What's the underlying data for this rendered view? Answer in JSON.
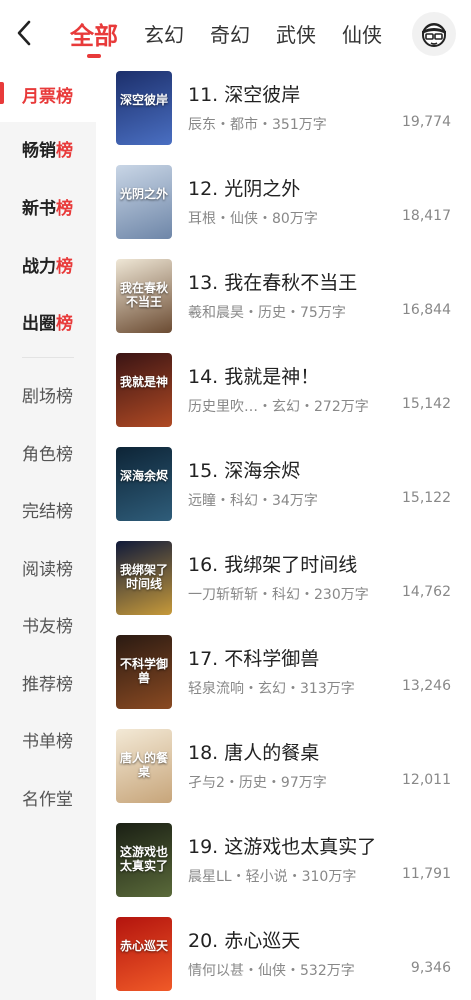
{
  "header": {
    "tabs": [
      {
        "label": "全部",
        "active": true
      },
      {
        "label": "玄幻",
        "active": false
      },
      {
        "label": "奇幻",
        "active": false
      },
      {
        "label": "武侠",
        "active": false
      },
      {
        "label": "仙侠",
        "active": false
      }
    ],
    "back_icon": "chevron-left-icon",
    "avatar_icon": "user-avatar-icon"
  },
  "sidebar": {
    "items": [
      {
        "label": "月票榜",
        "state": "active"
      },
      {
        "label": "畅销榜",
        "state": "bold"
      },
      {
        "label": "新书榜",
        "state": "bold"
      },
      {
        "label": "战力榜",
        "state": "bold"
      },
      {
        "label": "出圈榜",
        "state": "bold"
      },
      {
        "label": "剧场榜",
        "state": "normal"
      },
      {
        "label": "角色榜",
        "state": "normal"
      },
      {
        "label": "完结榜",
        "state": "normal"
      },
      {
        "label": "阅读榜",
        "state": "normal"
      },
      {
        "label": "书友榜",
        "state": "normal"
      },
      {
        "label": "推荐榜",
        "state": "normal"
      },
      {
        "label": "书单榜",
        "state": "normal"
      },
      {
        "label": "名作堂",
        "state": "normal"
      }
    ]
  },
  "books": [
    {
      "title": "11. 深空彼岸",
      "meta": "辰东・都市・351万字",
      "count": "19,774",
      "cover_text": "深空彼岸",
      "cover_colors": [
        "#1c2f6b",
        "#4a6fc2"
      ]
    },
    {
      "title": "12. 光阴之外",
      "meta": "耳根・仙侠・80万字",
      "count": "18,417",
      "cover_text": "光阴之外",
      "cover_colors": [
        "#c9d6e6",
        "#6e86a8"
      ]
    },
    {
      "title": "13. 我在春秋不当王",
      "meta": "羲和晨昊・历史・75万字",
      "count": "16,844",
      "cover_text": "我在春秋不当王",
      "cover_colors": [
        "#efe7d6",
        "#6b4b32"
      ]
    },
    {
      "title": "14. 我就是神！",
      "meta": "历史里吹…・玄幻・272万字",
      "count": "15,142",
      "cover_text": "我就是神",
      "cover_colors": [
        "#3a1414",
        "#b04a24"
      ]
    },
    {
      "title": "15. 深海余烬",
      "meta": "远瞳・科幻・34万字",
      "count": "15,122",
      "cover_text": "深海余烬",
      "cover_colors": [
        "#0d2436",
        "#2f5d7a"
      ]
    },
    {
      "title": "16. 我绑架了时间线",
      "meta": "一刀斩斩斩・科幻・230万字",
      "count": "14,762",
      "cover_text": "我绑架了时间线",
      "cover_colors": [
        "#101a3a",
        "#c79a3a"
      ]
    },
    {
      "title": "17. 不科学御兽",
      "meta": "轻泉流响・玄幻・313万字",
      "count": "13,246",
      "cover_text": "不科学御兽",
      "cover_colors": [
        "#2a1a12",
        "#8a4a22"
      ]
    },
    {
      "title": "18. 唐人的餐桌",
      "meta": "孑与2・历史・97万字",
      "count": "12,011",
      "cover_text": "唐人的餐桌",
      "cover_colors": [
        "#f3e9d6",
        "#c7a57a"
      ]
    },
    {
      "title": "19. 这游戏也太真实了",
      "meta": "晨星LL・轻小说・310万字",
      "count": "11,791",
      "cover_text": "这游戏也太真实了",
      "cover_colors": [
        "#1a1f14",
        "#5a6a3a"
      ]
    },
    {
      "title": "20. 赤心巡天",
      "meta": "情何以甚・仙侠・532万字",
      "count": "9,346",
      "cover_text": "赤心巡天",
      "cover_colors": [
        "#b3140e",
        "#f05a28"
      ]
    }
  ],
  "colors": {
    "accent": "#e83a3a",
    "sidebar_bg": "#f5f5f5",
    "meta_text": "#888888"
  }
}
